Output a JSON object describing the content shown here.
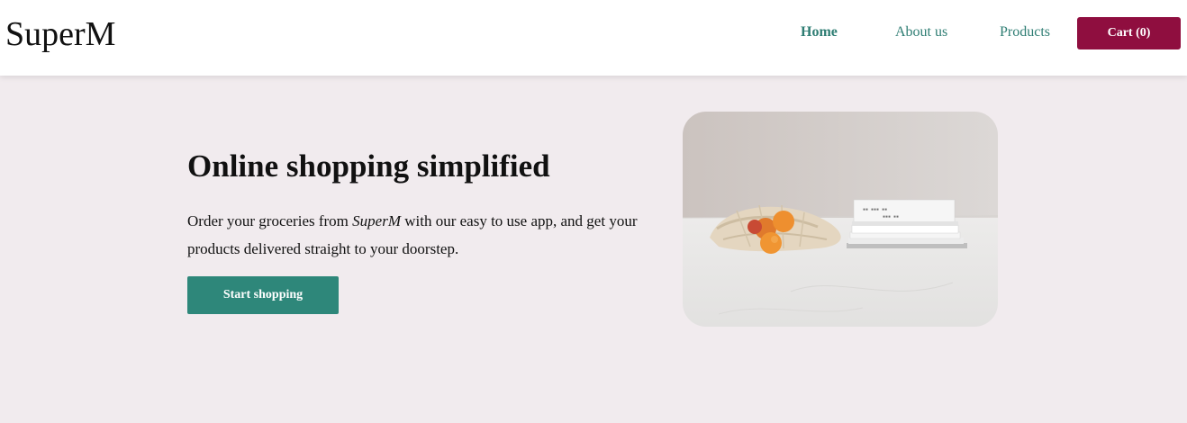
{
  "header": {
    "brand": "SuperM",
    "nav": {
      "home": "Home",
      "about": "About us",
      "products": "Products"
    },
    "cart_label": "Cart (0)"
  },
  "hero": {
    "title": "Online shopping simplified",
    "text_before": "Order your groceries from ",
    "text_brand": "SuperM",
    "text_after": " with our easy to use app, and get your products delivered straight to your doorstep.",
    "cta_label": "Start shopping",
    "image_description_icon": "groceries-photo"
  },
  "colors": {
    "page_background": "#f1ebee",
    "accent_green": "#2e877a",
    "nav_link": "#2e7d73",
    "cart_button": "#8f0e3f"
  }
}
